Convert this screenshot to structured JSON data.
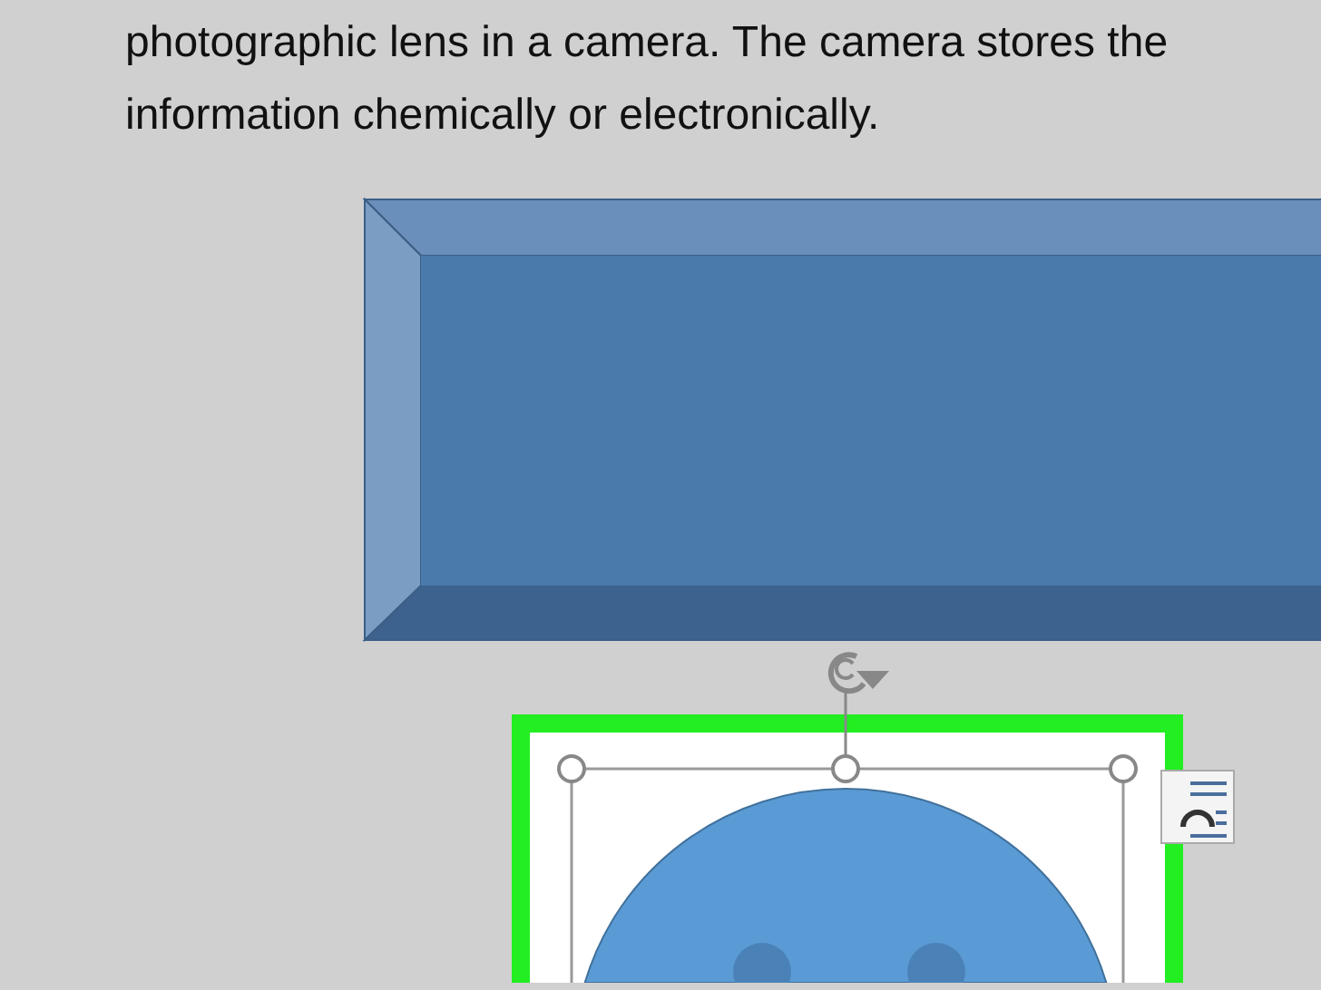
{
  "document": {
    "lines": [
      "photographic lens in a camera. The camera stores the",
      "information chemically or electronically."
    ]
  }
}
